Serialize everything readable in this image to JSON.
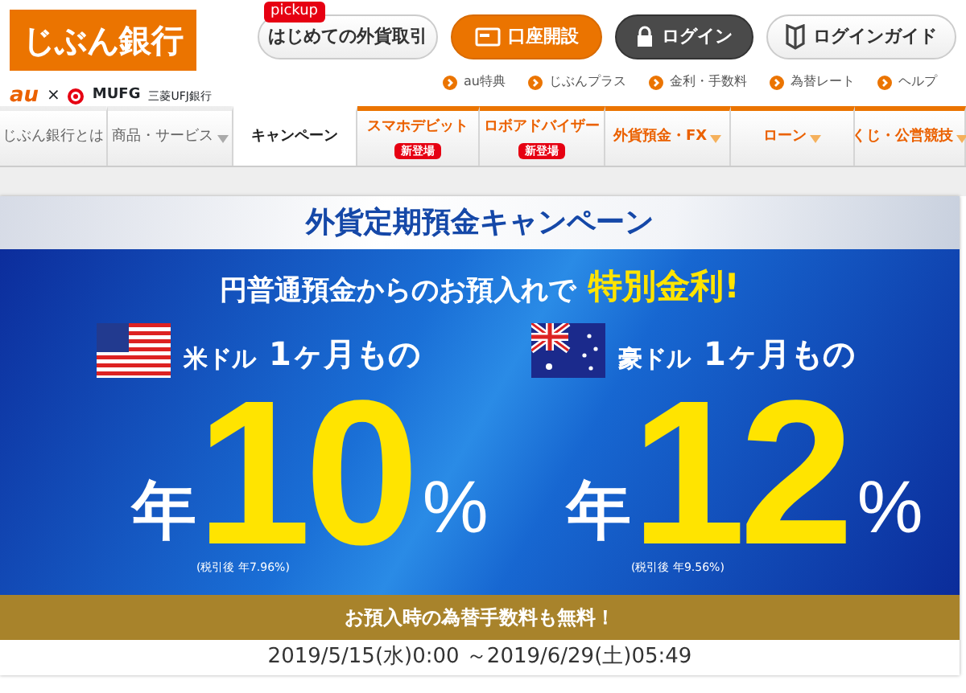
{
  "logo": {
    "text": "じぶん銀行",
    "partners": [
      "au",
      "×",
      "MUFG",
      "三菱UFJ銀行"
    ]
  },
  "header_buttons": [
    {
      "label": "はじめての外貨取引",
      "kind": "plain",
      "badge": "pickup"
    },
    {
      "label": "口座開設",
      "kind": "primary"
    },
    {
      "label": "ログイン",
      "kind": "dark"
    },
    {
      "label": "ログインガイド",
      "kind": "guide"
    }
  ],
  "quick_links": [
    "au特典",
    "じぶんプラス",
    "金利・手数料",
    "為替レート",
    "ヘルプ"
  ],
  "tabs": [
    {
      "label": "じぶん銀行とは",
      "kind": "plain",
      "selected": false,
      "dropdown": false
    },
    {
      "label": "商品・サービス",
      "kind": "plain",
      "selected": false,
      "dropdown": true
    },
    {
      "label": "キャンペーン",
      "kind": "plain",
      "selected": true,
      "dropdown": false
    },
    {
      "label": "スマホデビット",
      "kind": "featured",
      "selected": false,
      "dropdown": false,
      "badge": "新登場"
    },
    {
      "label": "ロボアドバイザー",
      "kind": "featured",
      "selected": false,
      "dropdown": false,
      "badge": "新登場"
    },
    {
      "label": "外貨預金・FX",
      "kind": "featured",
      "selected": false,
      "dropdown": true
    },
    {
      "label": "ローン",
      "kind": "featured",
      "selected": false,
      "dropdown": true
    },
    {
      "label": "くじ・公営競技",
      "kind": "featured",
      "selected": false,
      "dropdown": true
    }
  ],
  "banner": {
    "title": "外貨定期預金キャンペーン",
    "lead": "円普通預金からのお預入れで",
    "highlight": "特別金利!",
    "offers": [
      {
        "currency": "米ドル",
        "term": "1ヶ月もの",
        "prefix": "年",
        "rate": "10",
        "unit": "%",
        "note": "(税引後 年7.96%)"
      },
      {
        "currency": "豪ドル",
        "term": "1ヶ月もの",
        "prefix": "年",
        "rate": "12",
        "unit": "%",
        "note": "(税引後 年9.56%)"
      }
    ],
    "fee_note": "お預入時の為替手数料も**無料**！",
    "period": "2019/5/15(水)0:00 ～2019/6/29(土)05:49"
  }
}
